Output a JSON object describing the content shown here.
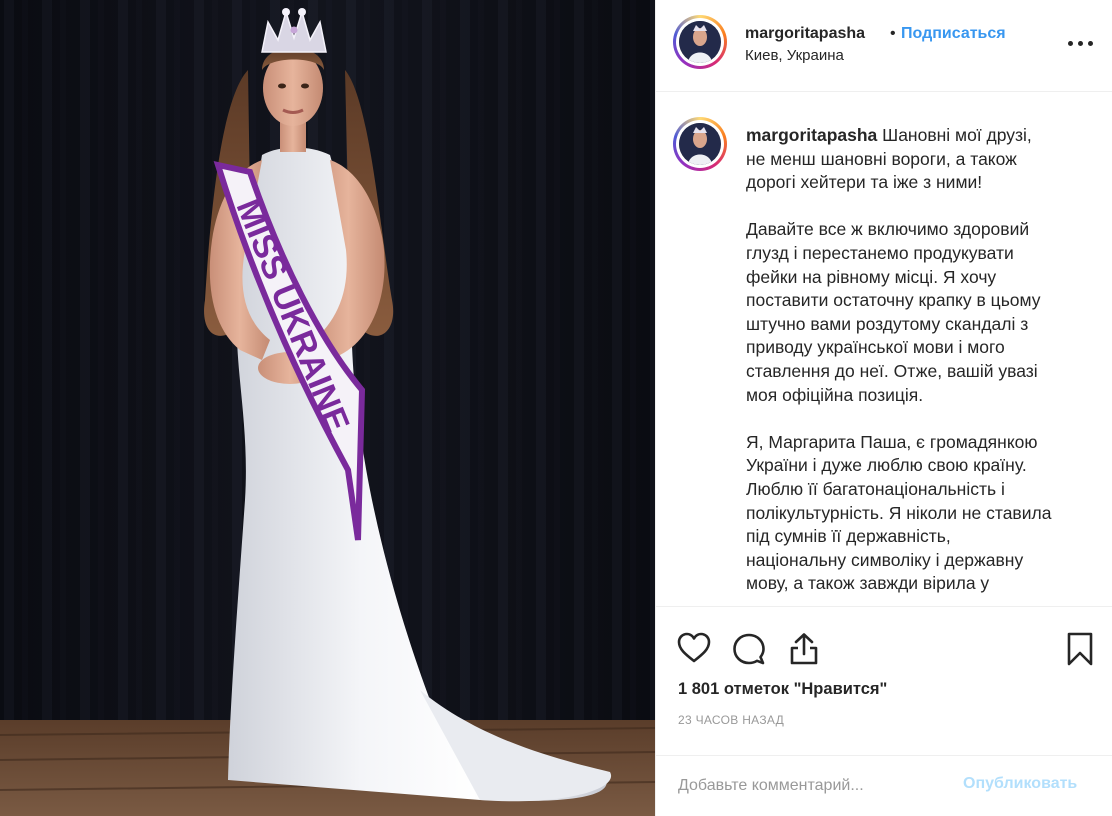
{
  "post": {
    "photo": {
      "description_icon": "photo-image",
      "sash_text": "MISS UKRAINE"
    },
    "header": {
      "username": "margoritapasha",
      "separator": "•",
      "follow_label": "Подписаться",
      "location": "Киев, Украина",
      "more_icon": "more-options-icon"
    },
    "caption": {
      "username": "margoritapasha",
      "text": " Шановні мої друзі,\nне менш шановні вороги, а також\nдорогі хейтери та іже з ними!\n\nДавайте все ж включимо здоровий\nглузд і перестанемо продукувати\nфейки на рівному місці. Я хочу\nпоставити остаточну крапку в цьому\nштучно вами роздутому скандалі з\nприводу української мови і мого\nставлення до неї. Отже, вашій увазі\nмоя офіційна позиція.\n\nЯ, Маргарита Паша, є громадянкою\nУкраїни і дуже люблю свою країну.\nЛюблю її багатонаціональність і\nполікультурність. Я ніколи не ставила\nпід сумнів її державність,\nнаціональну символіку і державну\nмову, а також завжди вірила у"
    },
    "actions": {
      "like_icon": "heart-icon",
      "comment_icon": "comment-icon",
      "share_icon": "share-icon",
      "save_icon": "bookmark-icon"
    },
    "likes_text": "1 801 отметок \"Нравится\"",
    "timestamp": "23 ЧАСОВ НАЗАД",
    "comment": {
      "placeholder": "Добавьте комментарий...",
      "publish_label": "Опубликовать"
    },
    "colors": {
      "link_blue": "#3897f0",
      "publish_disabled": "#b2dffc",
      "muted_text": "#999999",
      "text": "#262626"
    }
  }
}
